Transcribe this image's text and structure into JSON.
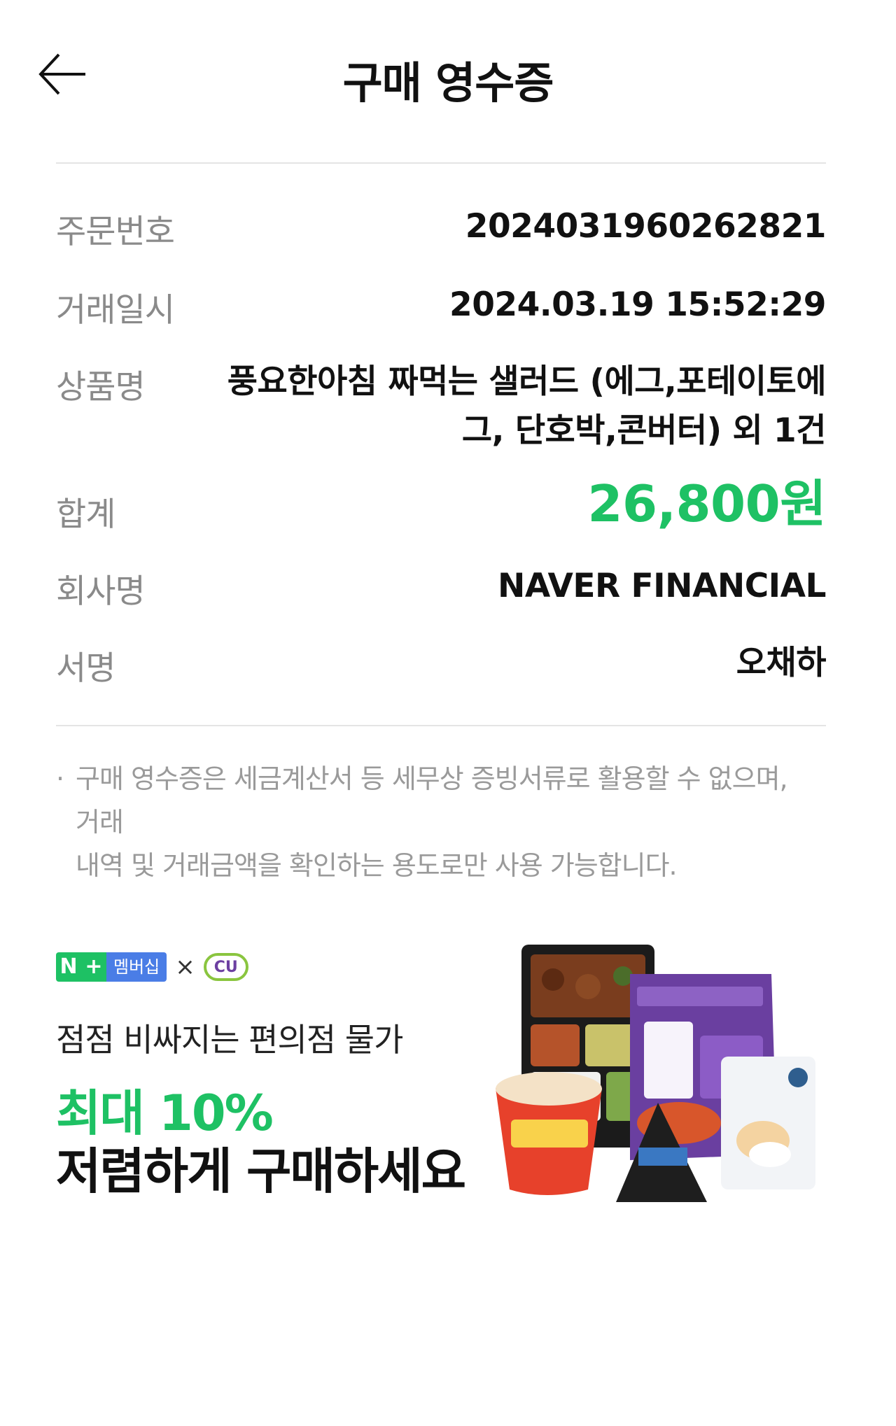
{
  "header": {
    "title": "구매 영수증"
  },
  "receipt": {
    "order_no_label": "주문번호",
    "order_no": "2024031960262821",
    "date_label": "거래일시",
    "date": "2024.03.19 15:52:29",
    "product_label": "상품명",
    "product_line1": "풍요한아침 짜먹는 샐러드 (에그,포테이토에",
    "product_line2": "그, 단호박,콘버터) 외 1건",
    "total_label": "합계",
    "total": "26,800원",
    "company_label": "회사명",
    "company": "NAVER FINANCIAL",
    "signature_label": "서명",
    "signature": "오채하"
  },
  "notice": {
    "bullet": "·",
    "line1": "구매 영수증은 세금계산서 등 세무상 증빙서류로 활용할 수 없으며, 거래",
    "line2": "내역 및 거래금액을 확인하는 용도로만 사용 가능합니다."
  },
  "banner": {
    "npay_n": "N",
    "npay_plus": "+",
    "membership": "멤버십",
    "times": "×",
    "cu": "CU",
    "line1": "점점 비싸지는 편의점 물가",
    "line2": "최대 10%",
    "line3": "저렴하게 구매하세요"
  },
  "colors": {
    "accent": "#1ec164",
    "label": "#8a8a8a",
    "divider": "#e4e4e4"
  },
  "icons": {
    "back": "arrow-left-icon"
  }
}
